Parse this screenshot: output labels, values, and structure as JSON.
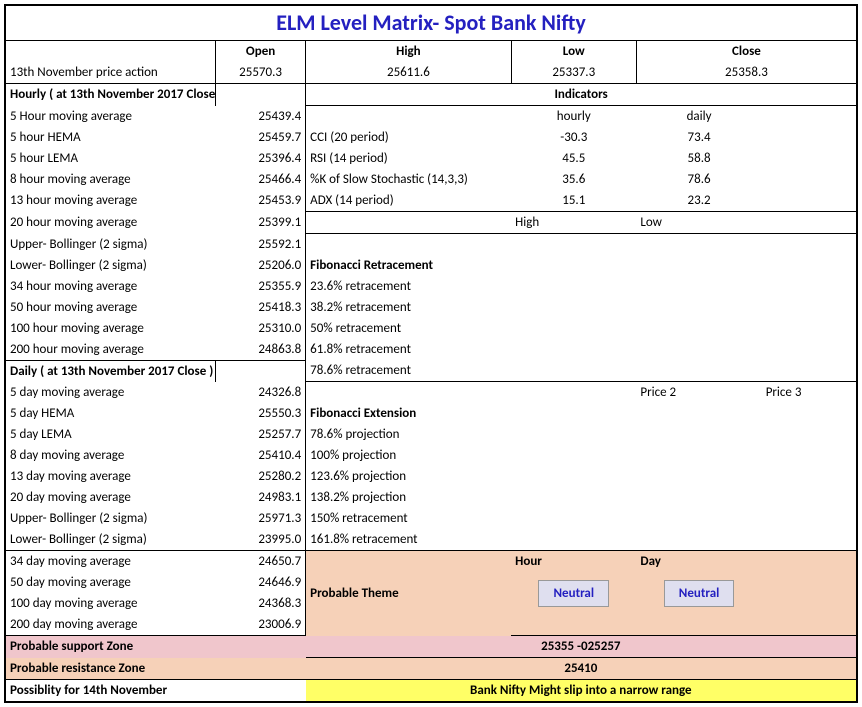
{
  "title": "ELM Level Matrix- Spot Bank Nifty",
  "ohlc": {
    "headers": [
      "Open",
      "High",
      "Low",
      "Close"
    ],
    "row_label": "13th November price action",
    "values": [
      "25570.3",
      "25611.6",
      "25337.3",
      "25358.3"
    ]
  },
  "hourly_header": "Hourly ( at 13th November 2017 Close)",
  "indicators_header": "Indicators",
  "daily_header": "Daily ( at 13th November 2017 Close )",
  "left_rows": [
    "5 Hour moving average",
    "5 hour HEMA",
    "5 hour LEMA",
    "8 hour moving average",
    "13 hour moving average",
    "20 hour moving average",
    "Upper- Bollinger (2 sigma)",
    "Lower- Bollinger (2 sigma)",
    "34 hour moving average",
    "50 hour moving average",
    "100 hour moving average",
    "200 hour moving average"
  ],
  "left_vals": [
    "25439.4",
    "25459.7",
    "25396.4",
    "25466.4",
    "25453.9",
    "25399.1",
    "25592.1",
    "25206.0",
    "25355.9",
    "25418.3",
    "25310.0",
    "24863.8"
  ],
  "daily_rows": [
    "5 day moving average",
    "5 day HEMA",
    "5 day LEMA",
    "8 day moving average",
    "13 day moving average",
    "20 day moving average",
    "Upper- Bollinger (2 sigma)",
    "Lower- Bollinger (2 sigma)",
    "34 day moving average",
    "50 day moving average",
    "100 day moving average",
    "200 day moving average"
  ],
  "daily_vals": [
    "24326.8",
    "25550.3",
    "25257.7",
    "25410.4",
    "25280.2",
    "24983.1",
    "25971.3",
    "23995.0",
    "24650.7",
    "24646.9",
    "24368.3",
    "23006.9"
  ],
  "ind_cols": {
    "hourly": "hourly",
    "daily": "daily"
  },
  "ind_rows": [
    {
      "name": "CCI (20 period)",
      "h": "-30.3",
      "d": "73.4"
    },
    {
      "name": "RSI (14 period)",
      "h": "45.5",
      "d": "58.8"
    },
    {
      "name": "%K of Slow Stochastic (14,3,3)",
      "h": "35.6",
      "d": "78.6"
    },
    {
      "name": "ADX (14 period)",
      "h": "15.1",
      "d": "23.2"
    }
  ],
  "hl": {
    "high": "High",
    "low": "Low"
  },
  "fib_retr_header": "Fibonacci Retracement",
  "fib_retr": [
    "23.6% retracement",
    "38.2% retracement",
    "50% retracement",
    "61.8% retracement",
    "78.6% retracement"
  ],
  "p2": "Price 2",
  "p3": "Price 3",
  "fib_ext_header": "Fibonacci Extension",
  "fib_ext": [
    "78.6% projection",
    "100% projection",
    "123.6% projection",
    "138.2% projection",
    "150% retracement",
    "161.8% retracement"
  ],
  "theme_label": "Probable Theme",
  "theme_cols": {
    "hour": "Hour",
    "day": "Day"
  },
  "theme_vals": {
    "hour": "Neutral",
    "day": "Neutral"
  },
  "support": {
    "label": "Probable support Zone",
    "value": "25355 -025257"
  },
  "resist": {
    "label": "Probable resistance Zone",
    "value": "25410"
  },
  "poss": {
    "label": "Possiblity for 14th November",
    "value": "Bank Nifty Might slip into a narrow range"
  }
}
